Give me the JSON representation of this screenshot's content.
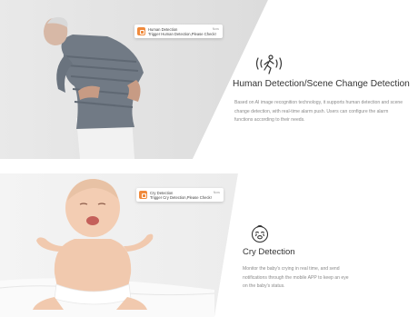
{
  "sections": [
    {
      "title": "Human Detection/Scene Change Detection",
      "description": "Based on AI image recognition technology, it supports human detection and scene change detection, with real-time alarm push. Users can configure the alarm functions according to their needs.",
      "icon": "running-person-icon",
      "notification": {
        "title": "Human Detection",
        "body": "Trigger Human Detection,Please Check!",
        "time": "Now"
      },
      "photo": "elderly-man-back-pain-photo"
    },
    {
      "title": "Cry Detection",
      "description": "Monitor the baby's crying in real time, and send notifications through the mobile APP to keep an eye on the baby's status.",
      "icon": "crying-baby-face-icon",
      "notification": {
        "title": "Cry Detection",
        "body": "Trigger Cry Detection,Please Check!",
        "time": "Now"
      },
      "photo": "crying-baby-photo"
    }
  ],
  "colors": {
    "app_icon": "#f08a3c",
    "title_text": "#333333",
    "body_text": "#8a8a8a",
    "panel_bg": "#f3f3f3"
  }
}
